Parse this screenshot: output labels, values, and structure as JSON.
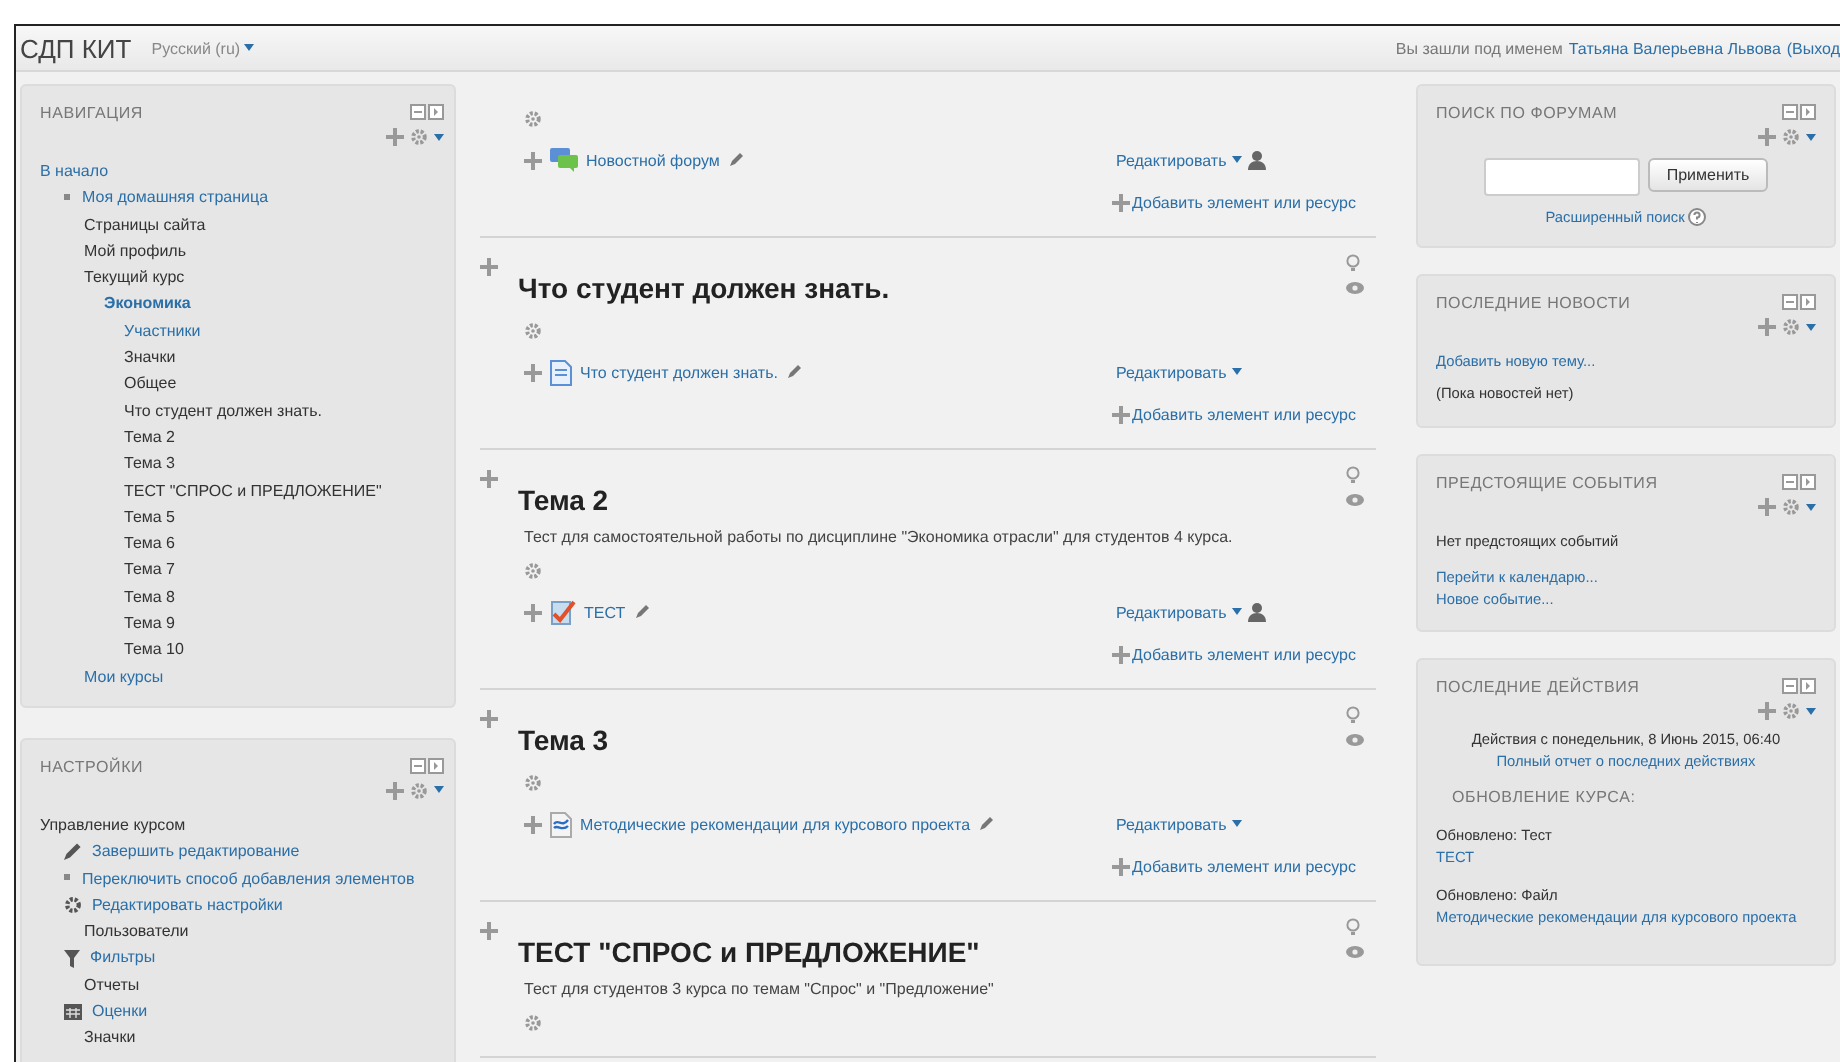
{
  "header": {
    "site_name": "СДП КИТ",
    "language": "Русский (ru)",
    "login_prefix": "Вы зашли под именем",
    "user_name": "Татьяна Валерьевна Львова",
    "logout": "(Выход"
  },
  "navigation": {
    "title": "НАВИГАЦИЯ",
    "items": [
      {
        "label": "В начало",
        "kind": "link",
        "children": [
          {
            "label": "Моя домашняя страница",
            "kind": "bullet-link"
          },
          {
            "label": "Страницы сайта",
            "kind": "text"
          },
          {
            "label": "Мой профиль",
            "kind": "text"
          },
          {
            "label": "Текущий курс",
            "kind": "text",
            "children": [
              {
                "label": "Экономика",
                "kind": "current",
                "children": [
                  {
                    "label": "Участники",
                    "kind": "link"
                  },
                  {
                    "label": "Значки",
                    "kind": "text"
                  },
                  {
                    "label": "Общее",
                    "kind": "text"
                  },
                  {
                    "label": "Что студент должен знать.",
                    "kind": "text"
                  },
                  {
                    "label": "Тема 2",
                    "kind": "text"
                  },
                  {
                    "label": "Тема 3",
                    "kind": "text"
                  },
                  {
                    "label": "ТЕСТ \"СПРОС и ПРЕДЛОЖЕНИЕ\"",
                    "kind": "text"
                  },
                  {
                    "label": "Тема 5",
                    "kind": "text"
                  },
                  {
                    "label": "Тема 6",
                    "kind": "text"
                  },
                  {
                    "label": "Тема 7",
                    "kind": "text"
                  },
                  {
                    "label": "Тема 8",
                    "kind": "text"
                  },
                  {
                    "label": "Тема 9",
                    "kind": "text"
                  },
                  {
                    "label": "Тема 10",
                    "kind": "text"
                  }
                ]
              }
            ]
          },
          {
            "label": "Мои курсы",
            "kind": "link"
          }
        ]
      }
    ]
  },
  "settings": {
    "title": "НАСТРОЙКИ",
    "items": [
      {
        "label": "Управление курсом",
        "kind": "text",
        "children": [
          {
            "label": "Завершить редактирование",
            "kind": "pencil-link"
          },
          {
            "label": "Переключить способ добавления элементов",
            "kind": "bullet-link"
          },
          {
            "label": "Редактировать настройки",
            "kind": "gear-link"
          },
          {
            "label": "Пользователи",
            "kind": "text"
          },
          {
            "label": "Фильтры",
            "kind": "filter-link"
          },
          {
            "label": "Отчеты",
            "kind": "text"
          },
          {
            "label": "Оценки",
            "kind": "grid-link"
          },
          {
            "label": "Значки",
            "kind": "text"
          }
        ]
      }
    ]
  },
  "sections": [
    {
      "activities": [
        {
          "kind": "forum",
          "name": "Новостной форум",
          "edit": "Редактировать",
          "assign_roles": true
        }
      ],
      "add": "Добавить элемент или ресурс"
    },
    {
      "title": "Что студент должен знать.",
      "activities": [
        {
          "kind": "page",
          "name": "Что студент должен знать.",
          "edit": "Редактировать",
          "assign_roles": false
        }
      ],
      "add": "Добавить элемент или ресурс"
    },
    {
      "title": "Тема 2",
      "summary": "Тест для самостоятельной работы по дисциплине \"Экономика отрасли\" для студентов 4 курса.",
      "activities": [
        {
          "kind": "quiz",
          "name": "ТЕСТ",
          "edit": "Редактировать",
          "assign_roles": true
        }
      ],
      "add": "Добавить элемент или ресурс"
    },
    {
      "title": "Тема 3",
      "activities": [
        {
          "kind": "document",
          "name": "Методические рекомендации для курсового проекта",
          "edit": "Редактировать",
          "assign_roles": false
        }
      ],
      "add": "Добавить элемент или ресурс"
    },
    {
      "title": "ТЕСТ \"СПРОС и ПРЕДЛОЖЕНИЕ\"",
      "summary": "Тест для студентов 3 курса по темам \"Спрос\" и \"Предложение\""
    }
  ],
  "forum_search": {
    "title": "ПОИСК ПО ФОРУМАМ",
    "button": "Применить",
    "advanced": "Расширенный поиск"
  },
  "latest_news": {
    "title": "ПОСЛЕДНИЕ НОВОСТИ",
    "add_topic": "Добавить новую тему...",
    "empty": "(Пока новостей нет)"
  },
  "upcoming_events": {
    "title": "ПРЕДСТОЯЩИЕ СОБЫТИЯ",
    "empty": "Нет предстоящих событий",
    "links": [
      "Перейти к календарю...",
      "Новое событие..."
    ]
  },
  "recent_activity": {
    "title": "ПОСЛЕДНИЕ ДЕЙСТВИЯ",
    "since": "Действия с понедельник, 8 Июнь 2015, 06:40",
    "full_report": "Полный отчет о последних действиях",
    "heading": "ОБНОВЛЕНИЕ КУРСА:",
    "updates": [
      {
        "label": "Обновлено: Тест",
        "link": "ТЕСТ"
      },
      {
        "label": "Обновлено: Файл",
        "link": "Методические рекомендации для курсового проекта"
      }
    ]
  }
}
